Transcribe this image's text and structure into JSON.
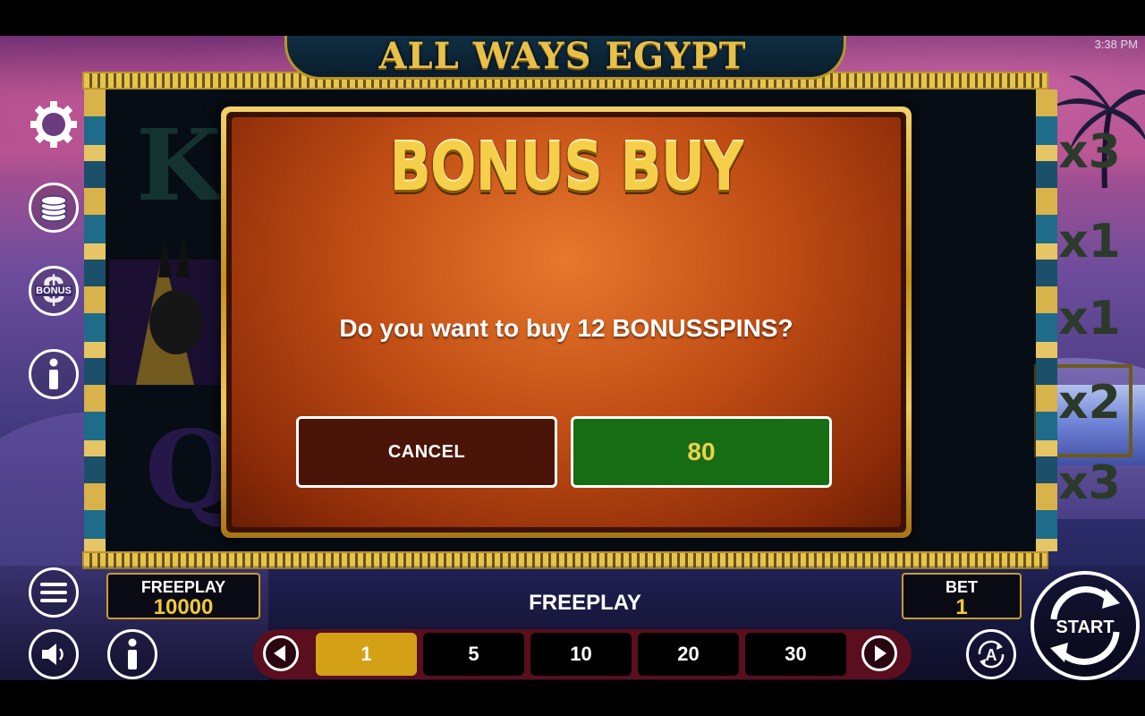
{
  "status_bar": {
    "time": "3:38 PM"
  },
  "game": {
    "title": "ALL WAYS EGYPT"
  },
  "reels": {
    "symbols": [
      "K",
      "Q"
    ],
    "multipliers": [
      "x3",
      "x1",
      "x1",
      "x2",
      "x3"
    ]
  },
  "dialog": {
    "title": "BONUS BUY",
    "question": "Do you want to buy 12 BONUSSPINS?",
    "cancel_label": "CANCEL",
    "confirm_label": "80"
  },
  "side_menu": {
    "items": [
      {
        "icon": "gear-icon"
      },
      {
        "icon": "coins-icon"
      },
      {
        "icon": "bonus-dollar-icon",
        "label": "BONUS"
      },
      {
        "icon": "info-icon"
      }
    ]
  },
  "bottom": {
    "balance_label": "FREEPLAY",
    "balance_value": "10000",
    "status_text": "FREEPLAY",
    "bet_label": "BET",
    "bet_value": "1",
    "bet_options": [
      "1",
      "5",
      "10",
      "20",
      "30"
    ],
    "selected_bet": "1",
    "start_label": "START",
    "auto_label": "A"
  },
  "colors": {
    "gold": "#e7c04a",
    "dialog_orange": "#c04d14",
    "confirm_green": "#166d14",
    "cancel_brown": "#4a1508",
    "bet_selected": "#d4a016"
  }
}
